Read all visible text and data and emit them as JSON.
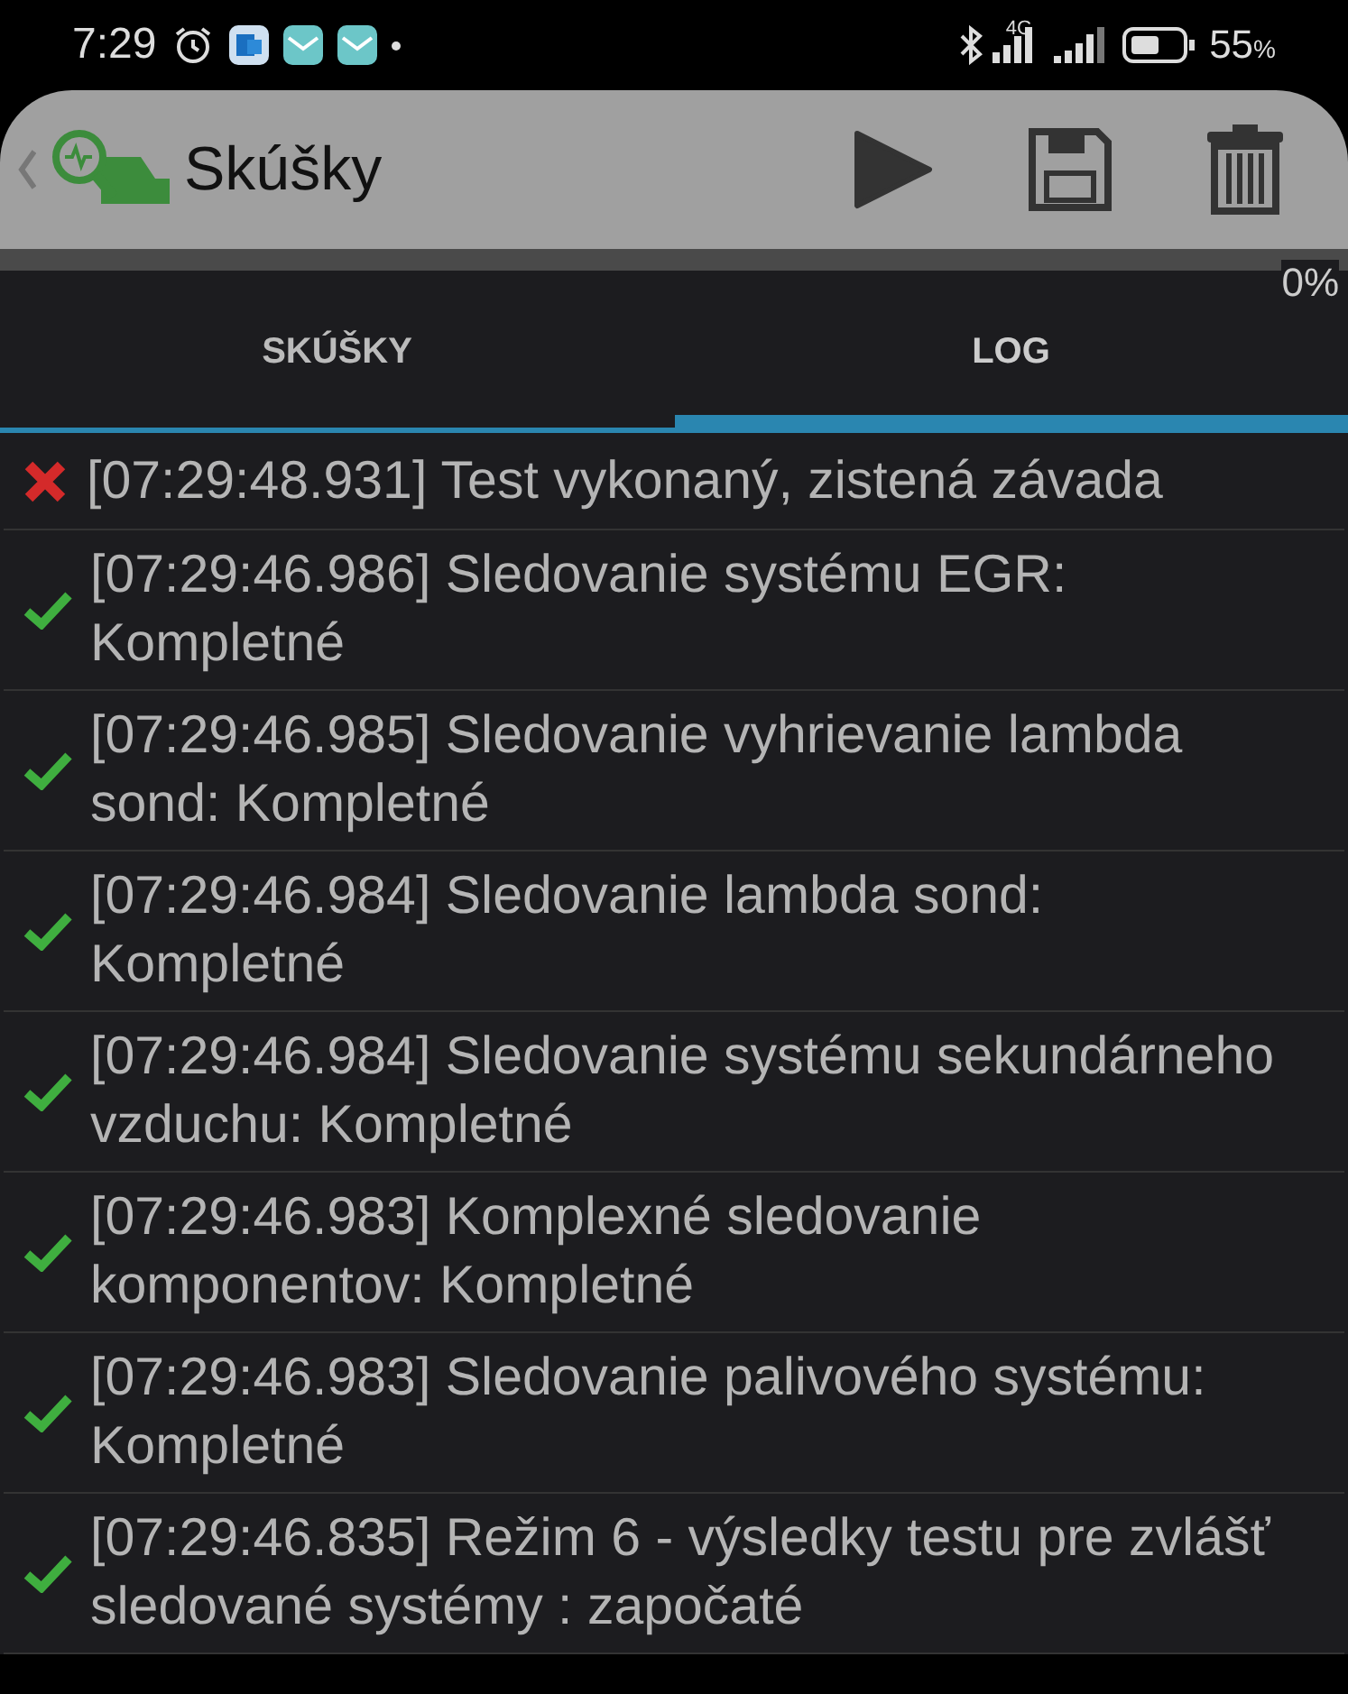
{
  "status_bar": {
    "time": "7:29",
    "network": "4G",
    "battery": "55",
    "battery_unit": "%"
  },
  "app_bar": {
    "title": "Skúšky"
  },
  "progress": {
    "level": 0,
    "reading": "0%"
  },
  "tabs": [
    {
      "label": "SKÚŠKY",
      "selected": false
    },
    {
      "label": "LOG",
      "selected": true
    }
  ],
  "log": [
    {
      "kind": "error",
      "text": "[07:29:48.931] Test vykonaný, zistená závada"
    },
    {
      "kind": "ok",
      "text": "[07:29:46.986] Sledovanie systému EGR: Kompletné"
    },
    {
      "kind": "ok",
      "text": "[07:29:46.985] Sledovanie vyhrievanie lambda sond: Kompletné"
    },
    {
      "kind": "ok",
      "text": "[07:29:46.984] Sledovanie lambda sond: Kompletné"
    },
    {
      "kind": "ok",
      "text": "[07:29:46.984] Sledovanie systému sekundárneho vzduchu: Kompletné"
    },
    {
      "kind": "ok",
      "text": "[07:29:46.983] Komplexné sledovanie komponentov: Kompletné"
    },
    {
      "kind": "ok",
      "text": "[07:29:46.983] Sledovanie palivového systému: Kompletné"
    },
    {
      "kind": "ok",
      "text": "[07:29:46.835] Režim 6 - výsledky testu pre zvlášť sledované systémy : započaté"
    }
  ]
}
